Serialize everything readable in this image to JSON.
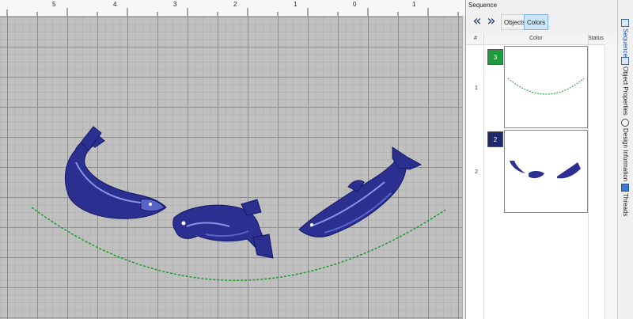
{
  "ruler": {
    "labels": [
      "5",
      "4",
      "3",
      "2",
      "1",
      "0",
      "1"
    ]
  },
  "design": {
    "thread_colors": {
      "fish": "#2b2f8f",
      "fish_highlight": "#5a63c9",
      "arc": "#1a9b2a"
    },
    "objects": [
      "fish-left",
      "fish-center",
      "fish-right",
      "curved-dashed-line"
    ]
  },
  "sequence": {
    "title": "Sequence",
    "nav": {
      "back_icon": "double-chevron-left",
      "forward_icon": "double-chevron-right"
    },
    "tabs": [
      {
        "label": "Objects",
        "active": false
      },
      {
        "label": "Colors",
        "active": true
      }
    ],
    "columns": {
      "num": "#",
      "color": "Color",
      "status": "Status"
    },
    "rows": [
      {
        "num": "1",
        "swatch_label": "3",
        "swatch_color": "#1e9b3c"
      },
      {
        "num": "2",
        "swatch_label": "2",
        "swatch_color": "#1f2a6e"
      }
    ]
  },
  "docker_tabs": [
    {
      "label": "Sequence",
      "icon": "sequence-icon",
      "active": true
    },
    {
      "label": "Object Properties",
      "icon": "object-properties-icon",
      "active": false
    },
    {
      "label": "Design Information",
      "icon": "info-icon",
      "active": false
    },
    {
      "label": "Threads",
      "icon": "threads-icon",
      "active": false
    }
  ]
}
